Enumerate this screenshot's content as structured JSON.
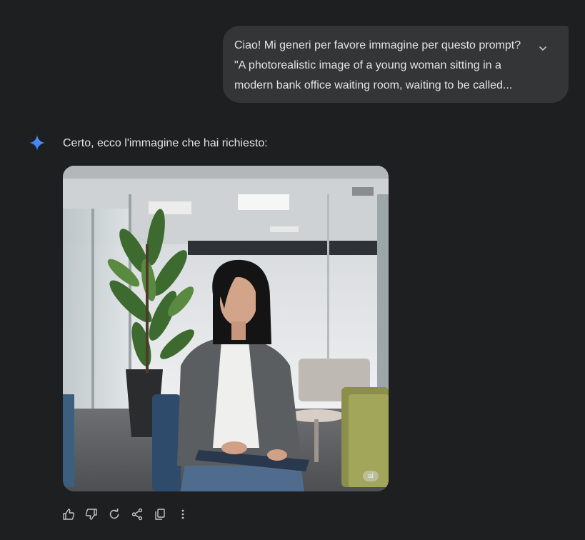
{
  "user_message": {
    "lines": [
      "Ciao! Mi generi per favore immagine per questo prompt?",
      "\"A photorealistic image of a young woman sitting in a",
      "modern bank office waiting room, waiting to be called..."
    ],
    "expand_icon": "chevron-down-icon"
  },
  "assistant": {
    "avatar_icon": "sparkle-star-icon",
    "reply": "Certo, ecco l'immagine che hai richiesto:",
    "image": {
      "watermark": "ai"
    },
    "actions": [
      {
        "icon": "thumbs-up-icon"
      },
      {
        "icon": "thumbs-down-icon"
      },
      {
        "icon": "refresh-icon"
      },
      {
        "icon": "share-icon"
      },
      {
        "icon": "copy-icon"
      },
      {
        "icon": "more-vert-icon"
      }
    ]
  },
  "colors": {
    "background": "#1e1f20",
    "user_bubble": "#333537",
    "text": "#e3e3e3",
    "icon": "#c4c7c5",
    "gemini_blue": "#4285f4"
  }
}
